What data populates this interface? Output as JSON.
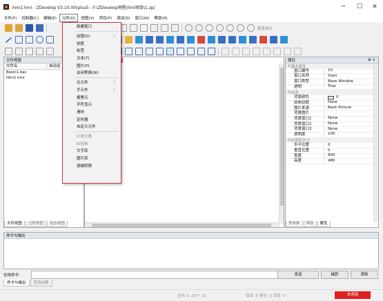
{
  "window": {
    "title": "hmi1.hmi - ZDevelop V3.10.00(plus5 - F:\\ZDevelop例程\\hmi项目\\1.zpj",
    "minimize": "─",
    "maximize": "☐",
    "close": "✕"
  },
  "menubar": [
    "文件(F)",
    "控制器(C)",
    "编辑(E)",
    "元件(D)",
    "视图(V)",
    "项目(P)",
    "调试(D)",
    "窗口(W)",
    "帮助(H)"
  ],
  "toolbar1": {
    "emergency_stop": "紧急停止"
  },
  "file_panel": {
    "title": "文件视图",
    "col_file": "文件名",
    "col_auto": "自动运",
    "files": [
      "Basic1.bas",
      "Hmi1.hmi"
    ],
    "tabs": [
      "文件视图",
      "过程视图",
      "组态视图"
    ]
  },
  "prop_panel": {
    "title": "属性",
    "groups": [
      {
        "name": "基本属性",
        "rows": [
          {
            "k": "窗口编号",
            "v": "10"
          },
          {
            "k": "窗口名称",
            "v": "Start"
          },
          {
            "k": "窗口类型",
            "v": "Base Window"
          },
          {
            "k": "透明",
            "v": "True"
          }
        ]
      },
      {
        "name": "外观",
        "rows": [
          {
            "k": "背景颜色",
            "v": "0"
          },
          {
            "k": "绘制边框",
            "v": "False"
          },
          {
            "k": "图片来源",
            "v": "Back Picture"
          },
          {
            "k": "背景图片",
            "v": ""
          },
          {
            "k": "背景窗口1",
            "v": "None"
          },
          {
            "k": "背景窗口2",
            "v": "None"
          },
          {
            "k": "背景窗口3",
            "v": "None"
          },
          {
            "k": "透明度",
            "v": "100"
          }
        ]
      },
      {
        "name": "位置和尺寸",
        "rows": [
          {
            "k": "水平位置",
            "v": "0"
          },
          {
            "k": "垂直位置",
            "v": "0"
          },
          {
            "k": "宽度",
            "v": "800"
          },
          {
            "k": "高度",
            "v": "480"
          }
        ]
      }
    ],
    "tabs": [
      "寄参数",
      "帮助",
      "属性"
    ]
  },
  "cmd_panel": {
    "title": "命令与输出",
    "online_label": "在线命令:",
    "input_value": "",
    "send": "发送",
    "capture": "捕获",
    "clear": "清除",
    "tabs": [
      "命令与输出",
      "查找结果"
    ]
  },
  "status": {
    "coords": "坐标 X: 28 Y: 15",
    "errors": "错误: 0  警告: 0  消息: 0",
    "conn": "未连接"
  },
  "dropdown": {
    "items": [
      {
        "label": "新建窗口",
        "sub": false,
        "disabled": false
      },
      {
        "sep": true
      },
      {
        "label": "绘图(D)",
        "sub": true,
        "disabled": false
      },
      {
        "label": "刻度",
        "sub": false,
        "disabled": false
      },
      {
        "label": "标签",
        "sub": false,
        "disabled": false
      },
      {
        "label": "文本(T)",
        "sub": false,
        "disabled": false
      },
      {
        "label": "图片(P)",
        "sub": false,
        "disabled": false
      },
      {
        "label": "关闭界面(W)",
        "sub": false,
        "disabled": false
      },
      {
        "sep": true
      },
      {
        "label": "位元件",
        "sub": true,
        "disabled": false
      },
      {
        "label": "字元件",
        "sub": true,
        "disabled": false
      },
      {
        "label": "报警元",
        "sub": false,
        "disabled": false
      },
      {
        "label": "字符显示",
        "sub": false,
        "disabled": false
      },
      {
        "label": "滑块",
        "sub": false,
        "disabled": false
      },
      {
        "label": "定时器",
        "sub": false,
        "disabled": false
      },
      {
        "label": "自定义元件",
        "sub": false,
        "disabled": false
      },
      {
        "sep": true
      },
      {
        "label": "示波元素",
        "sub": false,
        "disabled": true
      },
      {
        "label": "Ri控制",
        "sub": false,
        "disabled": true
      },
      {
        "label": "文字库",
        "sub": false,
        "disabled": false
      },
      {
        "label": "图片库",
        "sub": false,
        "disabled": false
      },
      {
        "label": "按键转换",
        "sub": false,
        "disabled": false
      }
    ]
  }
}
